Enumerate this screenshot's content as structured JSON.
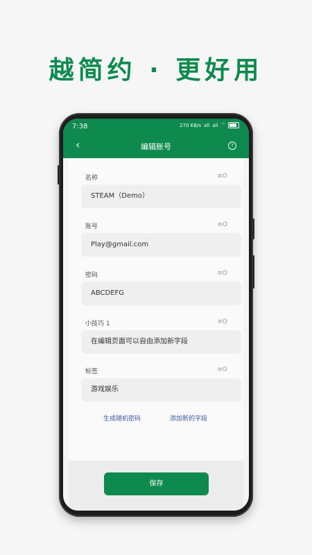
{
  "headline": "越简约 · 更好用",
  "status_bar": {
    "time": "7:38",
    "speed": "270 KB/s",
    "signal1": "all",
    "signal2": "all"
  },
  "app_bar": {
    "title": "编辑账号",
    "help": "?"
  },
  "fields": [
    {
      "label": "名称",
      "value": "STEAM（Demo）",
      "handle": "≡O"
    },
    {
      "label": "账号",
      "value": "Play@gmail.com",
      "handle": "≡O"
    },
    {
      "label": "密码",
      "value": "ABCDEFG",
      "handle": "≡O"
    },
    {
      "label": "小技巧 1",
      "value": "在编辑页面可以自由添加新字段",
      "handle": "≡O"
    },
    {
      "label": "标签",
      "value": "游戏娱乐",
      "handle": "≡O"
    }
  ],
  "links": {
    "generate_password": "生成随机密码",
    "add_field": "添加新的字段"
  },
  "save_label": "保存"
}
